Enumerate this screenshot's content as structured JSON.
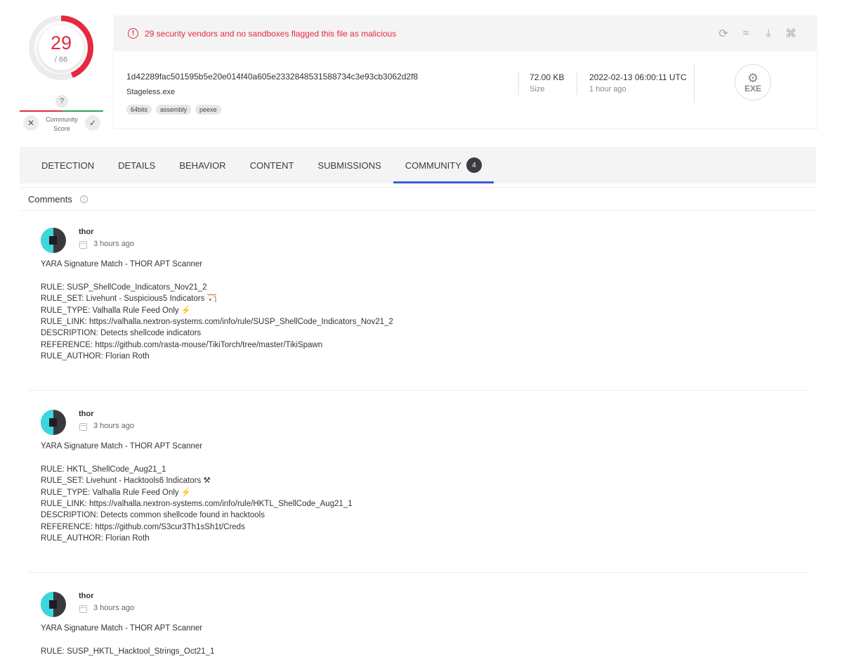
{
  "score": {
    "detections": "29",
    "total": "/ 66",
    "fraction": 0.4394
  },
  "community": {
    "question": "?",
    "label_line1": "Community",
    "label_line2": "Score",
    "negative_icon": "✕",
    "positive_icon": "✓"
  },
  "alert": {
    "icon": "!",
    "text": "29 security vendors and no sandboxes flagged this file as malicious"
  },
  "tools": [
    "reanalyze-icon",
    "similar-icon",
    "download-icon",
    "graph-icon"
  ],
  "file": {
    "hash": "1d42289fac501595b5e20e014f40a605e2332848531588734c3e93cb3062d2f8",
    "name": "Stageless.exe",
    "tags": [
      "64bits",
      "assembly",
      "peexe"
    ],
    "size_value": "72.00 KB",
    "size_label": "Size",
    "date_value": "2022-02-13 06:00:11 UTC",
    "date_label": "1 hour ago",
    "type_text": "EXE",
    "type_glyph": "⚙"
  },
  "tabs": [
    {
      "label": "DETECTION"
    },
    {
      "label": "DETAILS"
    },
    {
      "label": "BEHAVIOR"
    },
    {
      "label": "CONTENT"
    },
    {
      "label": "SUBMISSIONS"
    },
    {
      "label": "COMMUNITY",
      "badge": "4"
    }
  ],
  "comments_title": "Comments",
  "comments_info": "i",
  "comments": [
    {
      "author": "thor",
      "time": "3 hours ago",
      "lines": [
        "YARA Signature Match - THOR APT Scanner",
        "",
        "RULE: SUSP_ShellCode_Indicators_Nov21_2",
        "RULE_SET: Livehunt - Suspicious5 Indicators 🏹",
        "RULE_TYPE: Valhalla Rule Feed Only ⚡",
        "RULE_LINK: https://valhalla.nextron-systems.com/info/rule/SUSP_ShellCode_Indicators_Nov21_2",
        "DESCRIPTION: Detects shellcode indicators",
        "REFERENCE: https://github.com/rasta-mouse/TikiTorch/tree/master/TikiSpawn",
        "RULE_AUTHOR: Florian Roth"
      ]
    },
    {
      "author": "thor",
      "time": "3 hours ago",
      "lines": [
        "YARA Signature Match - THOR APT Scanner",
        "",
        "RULE: HKTL_ShellCode_Aug21_1",
        "RULE_SET: Livehunt - Hacktools6 Indicators ⚒",
        "RULE_TYPE: Valhalla Rule Feed Only ⚡",
        "RULE_LINK: https://valhalla.nextron-systems.com/info/rule/HKTL_ShellCode_Aug21_1",
        "DESCRIPTION: Detects common shellcode found in hacktools",
        "REFERENCE: https://github.com/S3cur3Th1sSh1t/Creds",
        "RULE_AUTHOR: Florian Roth"
      ]
    },
    {
      "author": "thor",
      "time": "3 hours ago",
      "lines": [
        "YARA Signature Match - THOR APT Scanner",
        "",
        "RULE: SUSP_HKTL_Hacktool_Strings_Oct21_1"
      ]
    }
  ],
  "colors": {
    "danger": "#e5293e",
    "accent": "#3d5bd9",
    "safe": "#2aa654"
  }
}
